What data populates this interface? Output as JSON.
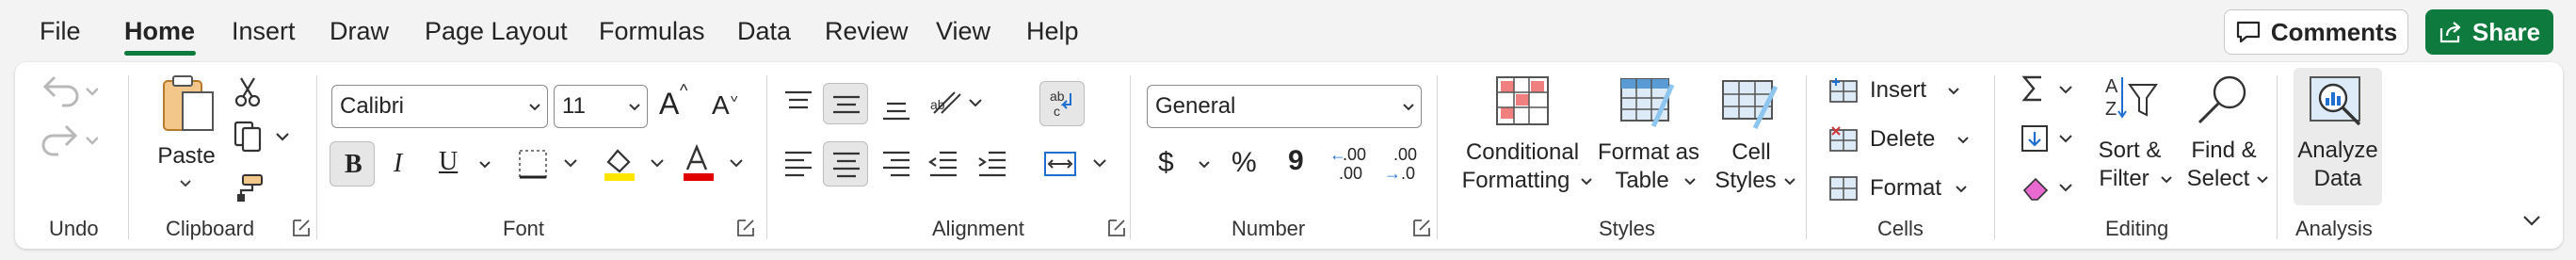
{
  "menu": {
    "tabs": [
      {
        "label": "File"
      },
      {
        "label": "Home"
      },
      {
        "label": "Insert"
      },
      {
        "label": "Draw"
      },
      {
        "label": "Page Layout"
      },
      {
        "label": "Formulas"
      },
      {
        "label": "Data"
      },
      {
        "label": "Review"
      },
      {
        "label": "View"
      },
      {
        "label": "Help"
      }
    ],
    "active": "Home",
    "comments_label": "Comments",
    "share_label": "Share"
  },
  "groups": {
    "undo": {
      "label": "Undo"
    },
    "clipboard": {
      "label": "Clipboard",
      "paste_label": "Paste"
    },
    "font": {
      "label": "Font",
      "font_name": "Calibri",
      "font_size": "11",
      "bold": "B",
      "italic": "I",
      "underline": "U",
      "grow": "A",
      "shrink": "A"
    },
    "alignment": {
      "label": "Alignment"
    },
    "number": {
      "label": "Number",
      "format": "General",
      "currency": "$",
      "percent": "%",
      "comma": "9",
      "inc_decimal": ".00",
      "dec_decimal": ".00"
    },
    "styles": {
      "label": "Styles",
      "conditional": "Conditional",
      "conditional2": "Formatting",
      "format_as": "Format as",
      "format_as2": "Table",
      "cell": "Cell",
      "cell2": "Styles"
    },
    "cells": {
      "label": "Cells",
      "insert": "Insert",
      "delete": "Delete",
      "format": "Format"
    },
    "editing": {
      "label": "Editing",
      "sort": "Sort &",
      "sort2": "Filter",
      "find": "Find &",
      "find2": "Select"
    },
    "analysis": {
      "label": "Analysis",
      "analyze": "Analyze",
      "analyze2": "Data"
    }
  },
  "colors": {
    "accent": "#0e7a3d",
    "highlight": "#ffe600",
    "font_color": "#e00000"
  }
}
